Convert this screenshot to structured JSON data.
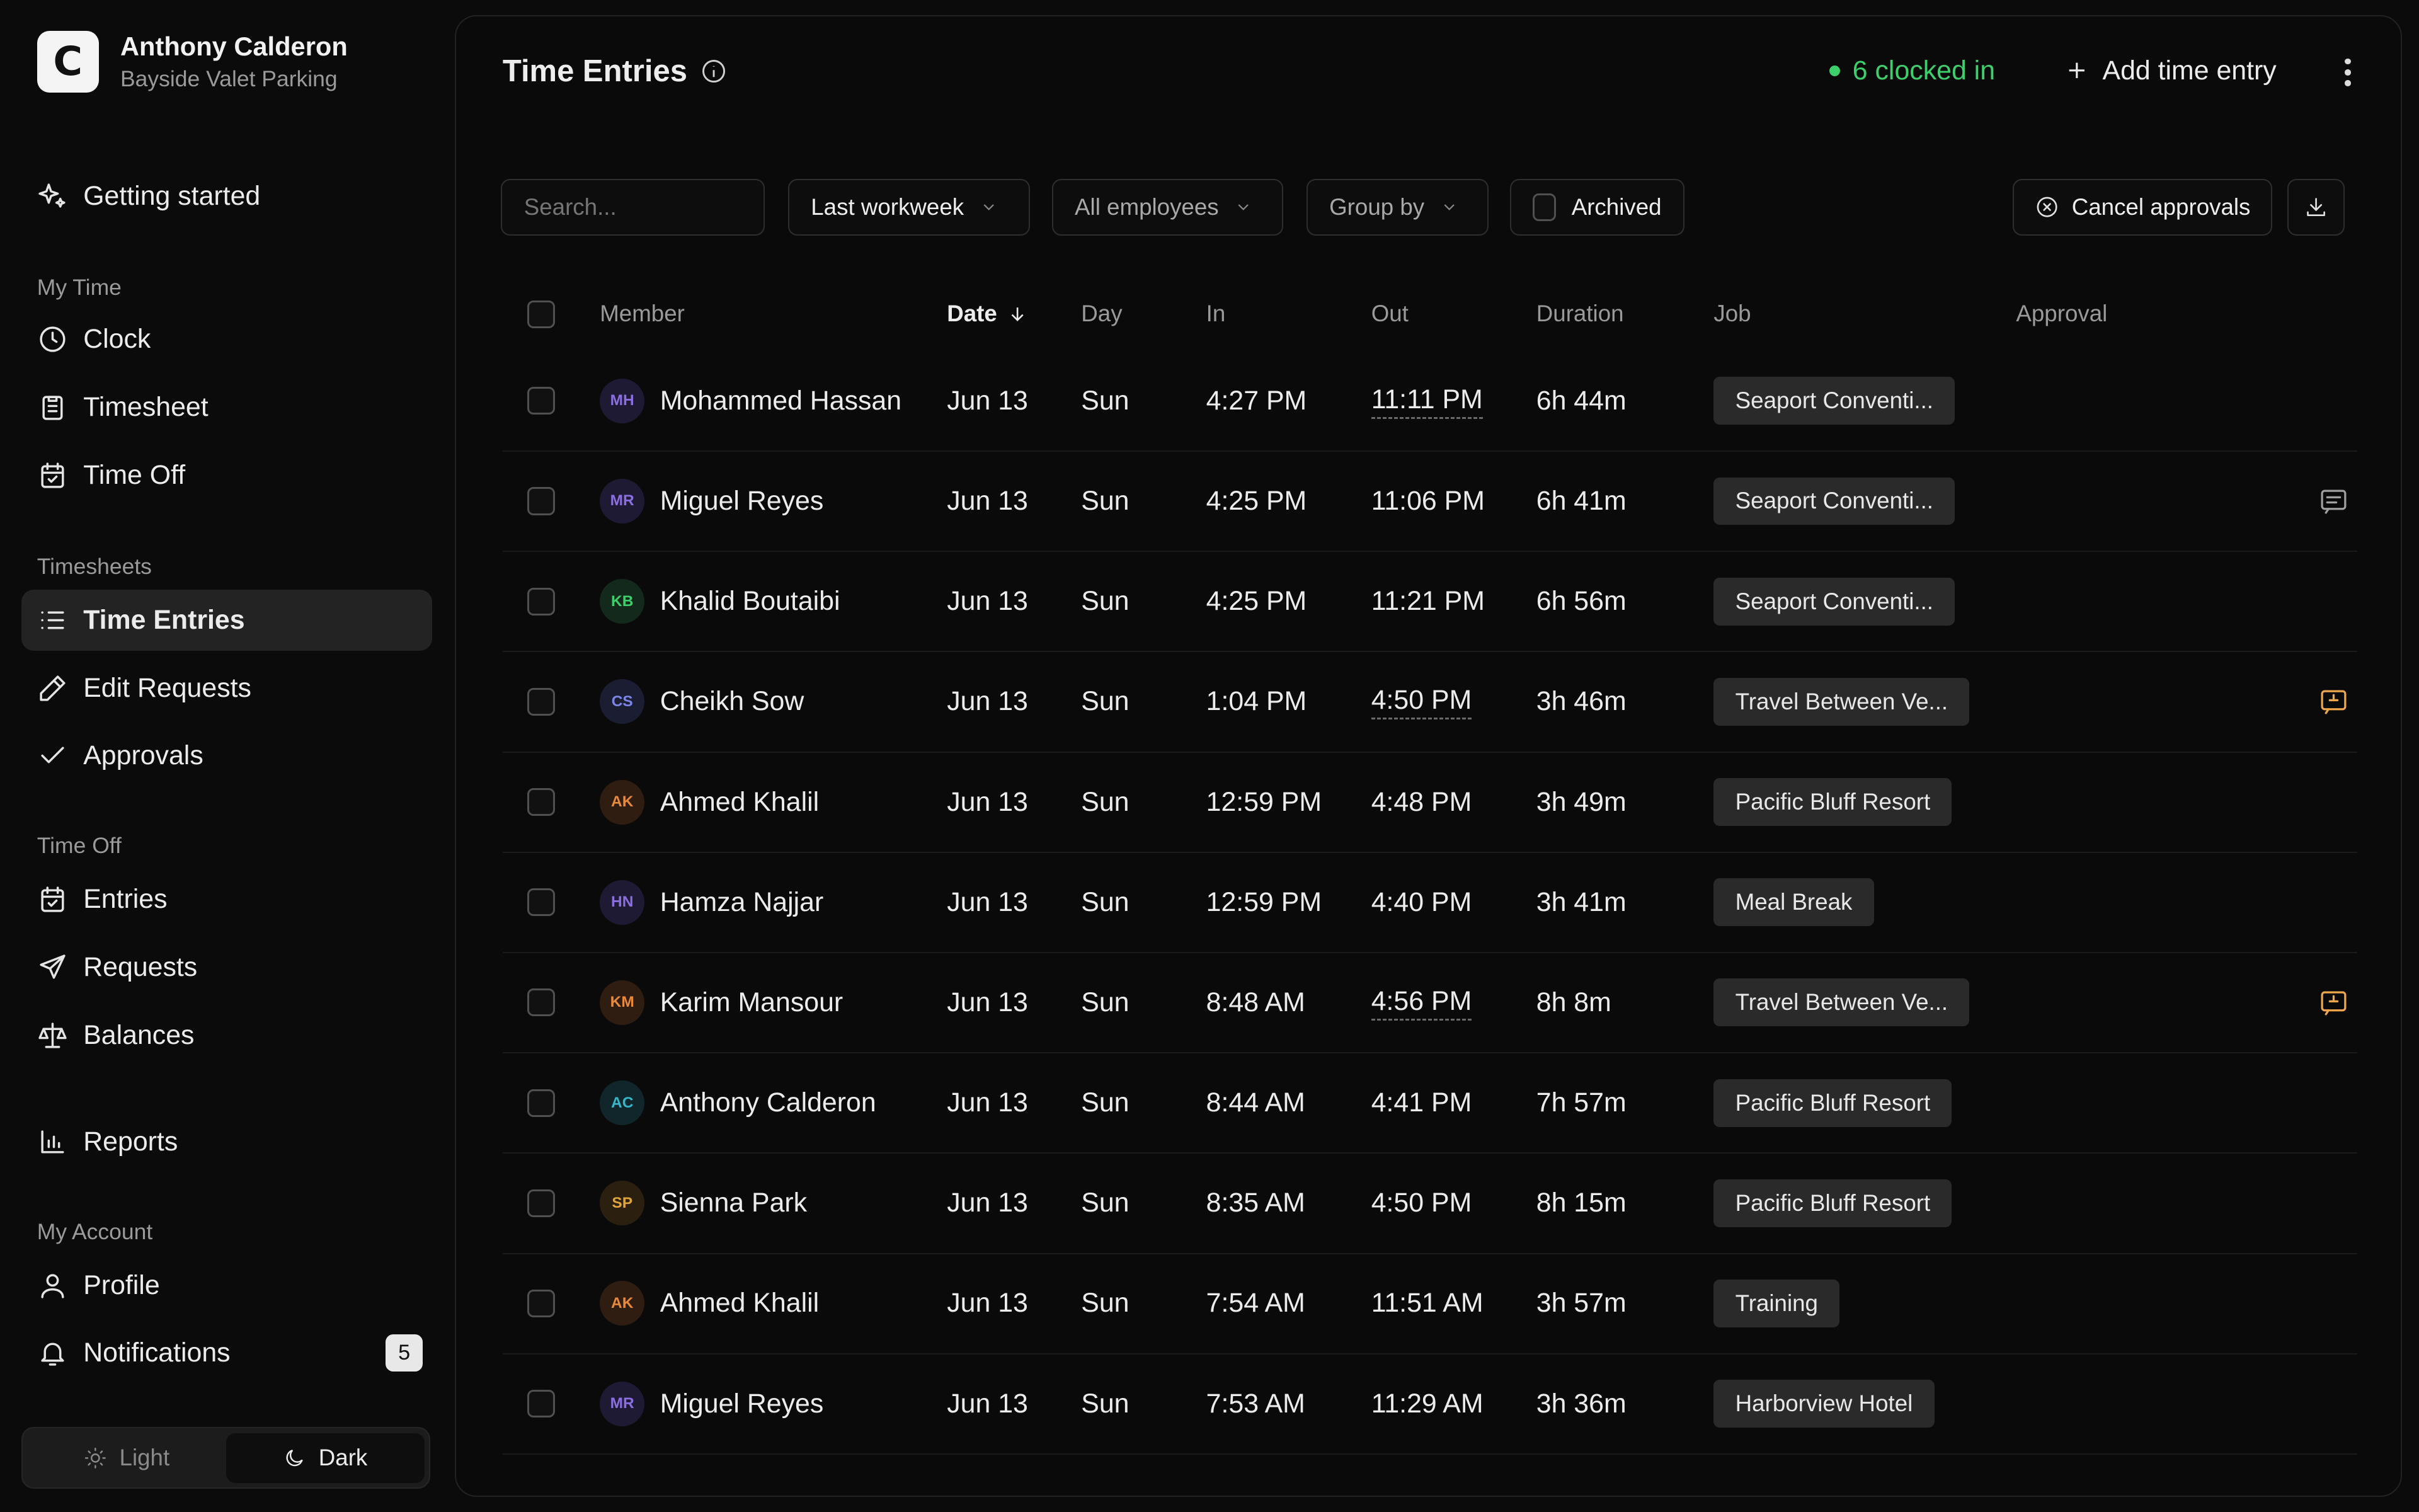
{
  "org": {
    "logo_letter": "C",
    "name": "Anthony Calderon",
    "company": "Bayside Valet Parking"
  },
  "nav": {
    "getting_started": "Getting started",
    "my_time_label": "My Time",
    "clock": "Clock",
    "timesheet": "Timesheet",
    "time_off_item": "Time Off",
    "timesheets_label": "Timesheets",
    "time_entries": "Time Entries",
    "edit_requests": "Edit Requests",
    "approvals": "Approvals",
    "time_off_label": "Time Off",
    "entries": "Entries",
    "requests": "Requests",
    "balances": "Balances",
    "reports": "Reports",
    "my_account_label": "My Account",
    "profile": "Profile",
    "notifications": "Notifications",
    "notifications_count": "5"
  },
  "theme": {
    "light": "Light",
    "dark": "Dark",
    "selected": "Dark"
  },
  "header": {
    "title": "Time Entries",
    "clocked_in": "6 clocked in",
    "add_entry": "Add time entry"
  },
  "filters": {
    "search_placeholder": "Search...",
    "period": "Last workweek",
    "employees": "All employees",
    "group_by": "Group by",
    "archived": "Archived",
    "cancel_approvals": "Cancel approvals"
  },
  "columns": {
    "member": "Member",
    "date": "Date",
    "day": "Day",
    "in": "In",
    "out": "Out",
    "duration": "Duration",
    "job": "Job",
    "approval": "Approval"
  },
  "colors": {
    "accent_green": "#3ecf6d",
    "note_orange": "#f0a64a",
    "note_gray": "#a0a0a0"
  },
  "rows": [
    {
      "initials": "MH",
      "avatar_color": "#8b6fe0",
      "avatar_bg": "#1f1a33",
      "member": "Mohammed Hassan",
      "date": "Jun 13",
      "day": "Sun",
      "in": "4:27 PM",
      "out": "11:11 PM",
      "out_edited": true,
      "duration": "6h 44m",
      "job": "Seaport Conventi...",
      "note": ""
    },
    {
      "initials": "MR",
      "avatar_color": "#8b6fe0",
      "avatar_bg": "#1f1a33",
      "member": "Miguel Reyes",
      "date": "Jun 13",
      "day": "Sun",
      "in": "4:25 PM",
      "out": "11:06 PM",
      "out_edited": false,
      "duration": "6h 41m",
      "job": "Seaport Conventi...",
      "note": "comment-icon"
    },
    {
      "initials": "KB",
      "avatar_color": "#3ecf6d",
      "avatar_bg": "#12291b",
      "member": "Khalid Boutaibi",
      "date": "Jun 13",
      "day": "Sun",
      "in": "4:25 PM",
      "out": "11:21 PM",
      "out_edited": false,
      "duration": "6h 56m",
      "job": "Seaport Conventi...",
      "note": ""
    },
    {
      "initials": "CS",
      "avatar_color": "#7c86e8",
      "avatar_bg": "#1b1d33",
      "member": "Cheikh Sow",
      "date": "Jun 13",
      "day": "Sun",
      "in": "1:04 PM",
      "out": "4:50 PM",
      "out_edited": true,
      "duration": "3h 46m",
      "job": "Travel Between Ve...",
      "note": "flagged-comment-icon"
    },
    {
      "initials": "AK",
      "avatar_color": "#e88a3c",
      "avatar_bg": "#2e1d10",
      "member": "Ahmed Khalil",
      "date": "Jun 13",
      "day": "Sun",
      "in": "12:59 PM",
      "out": "4:48 PM",
      "out_edited": false,
      "duration": "3h 49m",
      "job": "Pacific Bluff Resort",
      "note": ""
    },
    {
      "initials": "HN",
      "avatar_color": "#8b6fe0",
      "avatar_bg": "#1f1a33",
      "member": "Hamza Najjar",
      "date": "Jun 13",
      "day": "Sun",
      "in": "12:59 PM",
      "out": "4:40 PM",
      "out_edited": false,
      "duration": "3h 41m",
      "job": "Meal Break",
      "note": ""
    },
    {
      "initials": "KM",
      "avatar_color": "#e88a3c",
      "avatar_bg": "#2e1d10",
      "member": "Karim Mansour",
      "date": "Jun 13",
      "day": "Sun",
      "in": "8:48 AM",
      "out": "4:56 PM",
      "out_edited": true,
      "duration": "8h 8m",
      "job": "Travel Between Ve...",
      "note": "flagged-comment-icon"
    },
    {
      "initials": "AC",
      "avatar_color": "#35b7c9",
      "avatar_bg": "#10262a",
      "member": "Anthony Calderon",
      "date": "Jun 13",
      "day": "Sun",
      "in": "8:44 AM",
      "out": "4:41 PM",
      "out_edited": false,
      "duration": "7h 57m",
      "job": "Pacific Bluff Resort",
      "note": ""
    },
    {
      "initials": "SP",
      "avatar_color": "#e0a53a",
      "avatar_bg": "#2b200f",
      "member": "Sienna Park",
      "date": "Jun 13",
      "day": "Sun",
      "in": "8:35 AM",
      "out": "4:50 PM",
      "out_edited": false,
      "duration": "8h 15m",
      "job": "Pacific Bluff Resort",
      "note": ""
    },
    {
      "initials": "AK",
      "avatar_color": "#e88a3c",
      "avatar_bg": "#2e1d10",
      "member": "Ahmed Khalil",
      "date": "Jun 13",
      "day": "Sun",
      "in": "7:54 AM",
      "out": "11:51 AM",
      "out_edited": false,
      "duration": "3h 57m",
      "job": "Training",
      "note": ""
    },
    {
      "initials": "MR",
      "avatar_color": "#8b6fe0",
      "avatar_bg": "#1f1a33",
      "member": "Miguel Reyes",
      "date": "Jun 13",
      "day": "Sun",
      "in": "7:53 AM",
      "out": "11:29 AM",
      "out_edited": false,
      "duration": "3h 36m",
      "job": "Harborview Hotel",
      "note": ""
    }
  ]
}
